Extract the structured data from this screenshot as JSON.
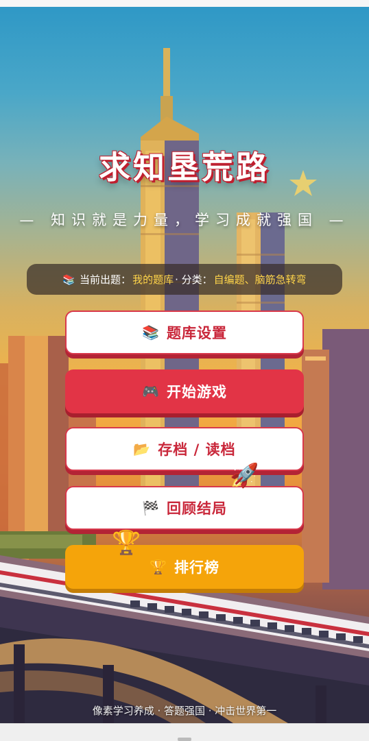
{
  "app": {
    "title": "求知垦荒路",
    "subtitle": "— 知识就是力量，学习成就强国 —"
  },
  "info": {
    "icon": "books-icon",
    "prefix": "当前出题：",
    "bank": "我的题库",
    "separator": " · 分类：",
    "categories": "自编题、脑筋急转弯"
  },
  "menu": {
    "question_bank": {
      "icon": "📚",
      "label": "题库设置"
    },
    "start_game": {
      "icon": "🎮",
      "label": "开始游戏"
    },
    "save_load": {
      "icon": "📂",
      "label": "存档 / 读档"
    },
    "review": {
      "icon": "🏁",
      "label": "回顾结局"
    },
    "leaderboard": {
      "icon": "🏆",
      "label": "排行榜"
    }
  },
  "footer": {
    "tagline": "像素学习养成 · 答题强国 · 冲击世界第一"
  },
  "decorations": {
    "star": "star-icon",
    "rocket": "🚀",
    "trophy": "🏆"
  },
  "colors": {
    "accent_red": "#e23446",
    "accent_orange": "#f5a40a",
    "highlight_yellow": "#ffd54a",
    "button_white": "#ffffff"
  }
}
